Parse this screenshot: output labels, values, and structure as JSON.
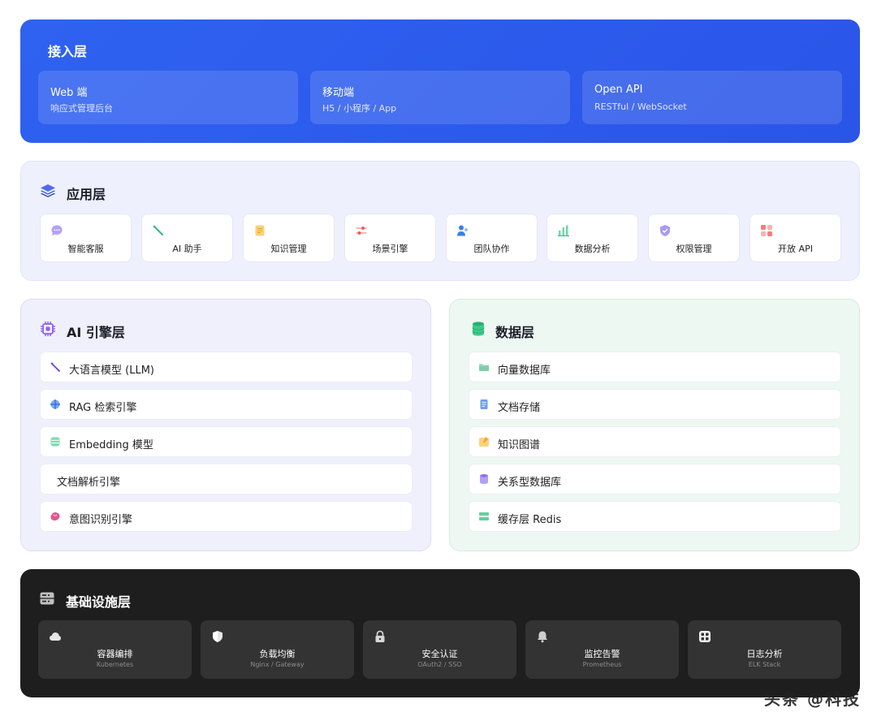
{
  "access": {
    "title": "接入层",
    "cards": [
      {
        "name": "Web 端",
        "sub": "响应式管理后台"
      },
      {
        "name": "移动端",
        "sub": "H5 / 小程序 / App"
      },
      {
        "name": "Open API",
        "sub": "RESTful / WebSocket"
      }
    ]
  },
  "application": {
    "title": "应用层",
    "icon": "layers-icon",
    "modules": [
      {
        "label": "智能客服",
        "icon": "chat-bubble-icon",
        "color": "#a78bfa"
      },
      {
        "label": "AI 助手",
        "icon": "magic-wand-icon",
        "color": "#34d399"
      },
      {
        "label": "知识管理",
        "icon": "notebook-icon",
        "color": "#fbbf24"
      },
      {
        "label": "场景引擎",
        "icon": "sliders-icon",
        "color": "#f87171"
      },
      {
        "label": "团队协作",
        "icon": "users-icon",
        "color": "#3b82f6"
      },
      {
        "label": "数据分析",
        "icon": "bar-chart-icon",
        "color": "#34d399"
      },
      {
        "label": "权限管理",
        "icon": "shield-check-icon",
        "color": "#8b5cf6"
      },
      {
        "label": "开放 API",
        "icon": "apps-grid-icon",
        "color": "#f87171"
      }
    ]
  },
  "ai_engine": {
    "title": "AI 引擎层",
    "icon": "chip-icon",
    "items": [
      {
        "label": "大语言模型 (LLM)",
        "icon": "magic-wand-icon",
        "color": "#7c3aed"
      },
      {
        "label": "RAG 检索引擎",
        "icon": "crosshair-icon",
        "color": "#3b82f6"
      },
      {
        "label": "Embedding 模型",
        "icon": "database-icon",
        "color": "#34d399"
      },
      {
        "label": "文档解析引擎",
        "icon": "",
        "color": ""
      },
      {
        "label": "意图识别引擎",
        "icon": "brain-icon",
        "color": "#ec4899"
      }
    ]
  },
  "data_layer": {
    "title": "数据层",
    "icon": "database-stack-icon",
    "items": [
      {
        "label": "向量数据库",
        "icon": "folder-icon",
        "color": "#86d3b0"
      },
      {
        "label": "文档存储",
        "icon": "document-icon",
        "color": "#60a5fa"
      },
      {
        "label": "知识图谱",
        "icon": "note-icon",
        "color": "#fbbf24"
      },
      {
        "label": "关系型数据库",
        "icon": "cylinder-icon",
        "color": "#a78bfa"
      },
      {
        "label": "缓存层 Redis",
        "icon": "server-icon",
        "color": "#34d399"
      }
    ]
  },
  "infrastructure": {
    "title": "基础设施层",
    "icon": "server-rack-icon",
    "cards": [
      {
        "name": "容器编排",
        "sub": "Kubernetes",
        "icon": "cloud-icon"
      },
      {
        "name": "负载均衡",
        "sub": "Nginx / Gateway",
        "icon": "shield-icon"
      },
      {
        "name": "安全认证",
        "sub": "OAuth2 / SSO",
        "icon": "lock-icon"
      },
      {
        "name": "监控告警",
        "sub": "Prometheus",
        "icon": "bell-icon"
      },
      {
        "name": "日志分析",
        "sub": "ELK Stack",
        "icon": "grid-icon"
      }
    ]
  },
  "watermark": "头条 @科技"
}
